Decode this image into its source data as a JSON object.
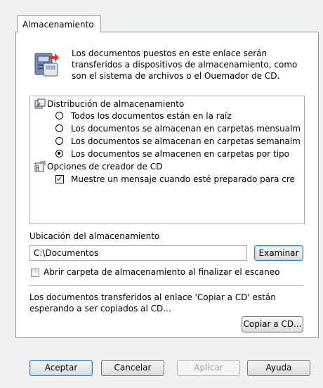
{
  "tab": {
    "label": "Almacenamiento"
  },
  "intro": {
    "text": "Los documentos puestos en este enlace serán transferidos a dispositivos de almacenamiento, como son el sistema de archivos o el Ouemador de CD.",
    "icon": "storage-transfer-icon"
  },
  "tree": {
    "group1": {
      "label": "Distribución de almacenamiento",
      "icon": "storage-distribution-icon"
    },
    "options": [
      {
        "label": "Todos los documentos están en la raíz",
        "selected": false
      },
      {
        "label": "Los documentos se almacenan en carpetas mensualm",
        "selected": false
      },
      {
        "label": "Los documentos se almacenan en carpetas semanalm",
        "selected": false
      },
      {
        "label": "Los documentos se almacenen en carpetas por tipo",
        "selected": true
      }
    ],
    "group2": {
      "label": "Opciones de creador de CD",
      "icon": "cd-options-icon"
    },
    "cd_option": {
      "label": "Muestre un mensaje cuando esté preparado para cre",
      "checked": true
    }
  },
  "location": {
    "label": "Ubicación del almacenamiento",
    "value": "C:\\Documentos",
    "browse_label": "Examinar"
  },
  "open_folder": {
    "label": "Abrir carpeta de almacenamiento al finalizar el escaneo",
    "checked": false
  },
  "cd_status": {
    "text": "Los documentos transferidos al enlace 'Copiar a CD' están esperando a ser copiados al CD...",
    "button_label": "Copiar a CD..."
  },
  "footer": {
    "ok": "Aceptar",
    "cancel": "Cancelar",
    "apply": "Aplicar",
    "help": "Ayuda"
  }
}
